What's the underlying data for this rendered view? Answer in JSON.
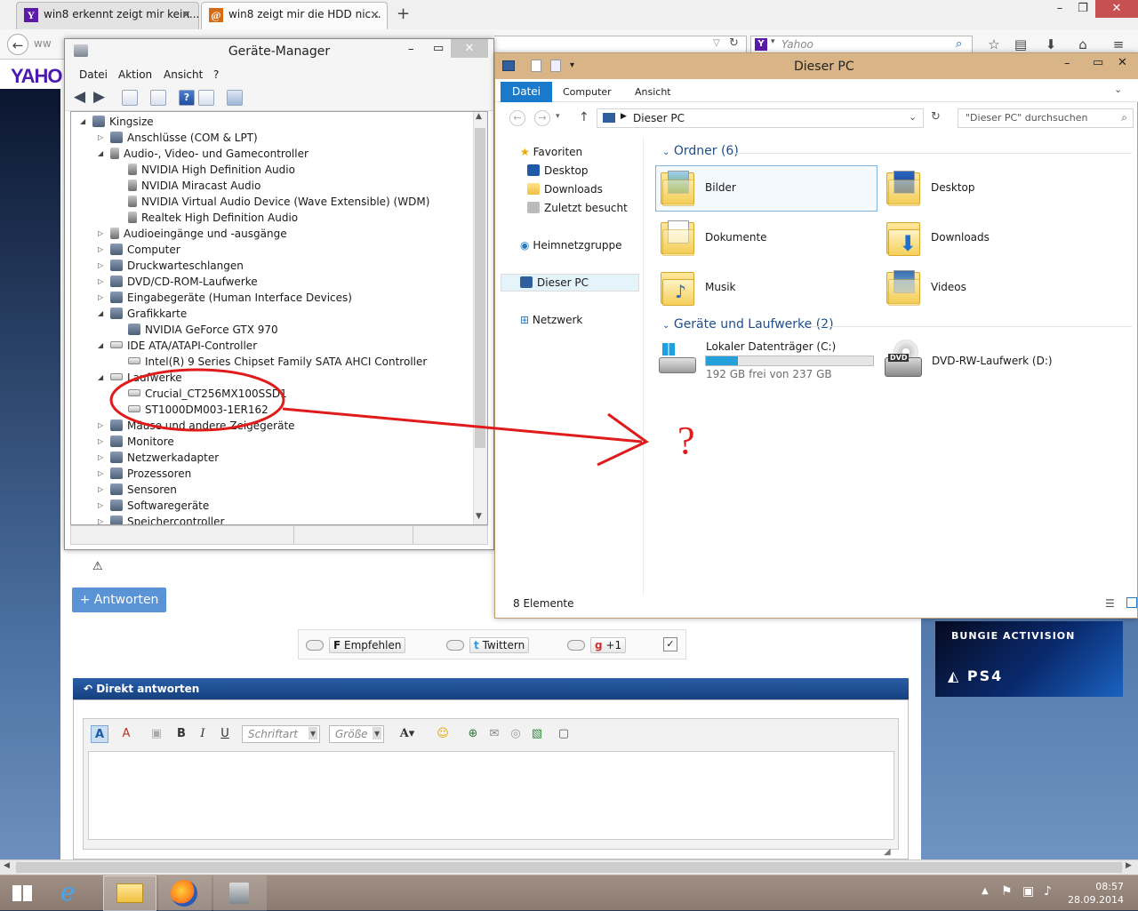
{
  "browser": {
    "tabs": [
      {
        "title": "win8 erkennt zeigt mir kein..."
      },
      {
        "title": "win8 zeigt mir die HDD nic..."
      }
    ],
    "new_tab": "+",
    "url_placeholder": "ww",
    "search_placeholder": "Yahoo",
    "page_logo": "YAHO"
  },
  "device_manager": {
    "title": "Geräte-Manager",
    "menu": [
      "Datei",
      "Aktion",
      "Ansicht",
      "?"
    ],
    "tree": [
      {
        "label": "Kingsize",
        "level": 0,
        "state": "open",
        "icon": "computer-icon"
      },
      {
        "label": "Anschlüsse (COM & LPT)",
        "level": 1,
        "state": "closed",
        "icon": "port-icon"
      },
      {
        "label": "Audio-, Video- und Gamecontroller",
        "level": 1,
        "state": "open",
        "icon": "speaker-icon"
      },
      {
        "label": "NVIDIA High Definition Audio",
        "level": 2,
        "state": "leaf",
        "icon": "speaker-icon"
      },
      {
        "label": "NVIDIA Miracast Audio",
        "level": 2,
        "state": "leaf",
        "icon": "speaker-icon"
      },
      {
        "label": "NVIDIA Virtual Audio Device (Wave Extensible) (WDM)",
        "level": 2,
        "state": "leaf",
        "icon": "speaker-icon"
      },
      {
        "label": "Realtek High Definition Audio",
        "level": 2,
        "state": "leaf",
        "icon": "speaker-icon"
      },
      {
        "label": "Audioeingänge und -ausgänge",
        "level": 1,
        "state": "closed",
        "icon": "speaker-icon"
      },
      {
        "label": "Computer",
        "level": 1,
        "state": "closed",
        "icon": "monitor-icon"
      },
      {
        "label": "Druckwarteschlangen",
        "level": 1,
        "state": "closed",
        "icon": "printer-icon"
      },
      {
        "label": "DVD/CD-ROM-Laufwerke",
        "level": 1,
        "state": "closed",
        "icon": "dvd-icon"
      },
      {
        "label": "Eingabegeräte (Human Interface Devices)",
        "level": 1,
        "state": "closed",
        "icon": "hid-icon"
      },
      {
        "label": "Grafikkarte",
        "level": 1,
        "state": "open",
        "icon": "monitor-icon"
      },
      {
        "label": "NVIDIA GeForce GTX 970",
        "level": 2,
        "state": "leaf",
        "icon": "monitor-icon"
      },
      {
        "label": "IDE ATA/ATAPI-Controller",
        "level": 1,
        "state": "open",
        "icon": "drive-icon"
      },
      {
        "label": "Intel(R) 9 Series Chipset Family SATA AHCI Controller",
        "level": 2,
        "state": "leaf",
        "icon": "drive-icon"
      },
      {
        "label": "Laufwerke",
        "level": 1,
        "state": "open",
        "icon": "drive-icon"
      },
      {
        "label": "Crucial_CT256MX100SSD1",
        "level": 2,
        "state": "leaf",
        "icon": "drive-icon"
      },
      {
        "label": "ST1000DM003-1ER162",
        "level": 2,
        "state": "leaf",
        "icon": "drive-icon"
      },
      {
        "label": "Mäuse und andere Zeigegeräte",
        "level": 1,
        "state": "closed",
        "icon": "mouse-icon"
      },
      {
        "label": "Monitore",
        "level": 1,
        "state": "closed",
        "icon": "monitor-icon"
      },
      {
        "label": "Netzwerkadapter",
        "level": 1,
        "state": "closed",
        "icon": "network-icon"
      },
      {
        "label": "Prozessoren",
        "level": 1,
        "state": "closed",
        "icon": "cpu-icon"
      },
      {
        "label": "Sensoren",
        "level": 1,
        "state": "closed",
        "icon": "sensor-icon"
      },
      {
        "label": "Softwaregeräte",
        "level": 1,
        "state": "closed",
        "icon": "software-icon"
      },
      {
        "label": "Speichercontroller",
        "level": 1,
        "state": "closed",
        "icon": "storage-icon"
      }
    ]
  },
  "explorer": {
    "title": "Dieser PC",
    "ribbon_tabs": [
      "Datei",
      "Computer",
      "Ansicht"
    ],
    "address": "Dieser PC",
    "search_placeholder": "\"Dieser PC\" durchsuchen",
    "nav": {
      "favorites": "Favoriten",
      "fav_items": [
        "Desktop",
        "Downloads",
        "Zuletzt besucht"
      ],
      "homegroup": "Heimnetzgruppe",
      "this_pc": "Dieser PC",
      "network": "Netzwerk"
    },
    "folders_header": "Ordner (6)",
    "folders": [
      "Bilder",
      "Desktop",
      "Dokumente",
      "Downloads",
      "Musik",
      "Videos"
    ],
    "drives_header": "Geräte und Laufwerke (2)",
    "drives": [
      {
        "name": "Lokaler Datenträger (C:)",
        "free": "192 GB frei von 237 GB",
        "used_fraction": 0.19
      },
      {
        "name": "DVD-RW-Laufwerk (D:)",
        "badge": "DVD"
      }
    ],
    "status": "8 Elemente"
  },
  "annotation": {
    "mark": "?",
    "color": "#e01b1b"
  },
  "forum": {
    "reply_button": "+ Antworten",
    "social": [
      {
        "label": "Empfehlen",
        "glyph": "F"
      },
      {
        "label": "Twittern",
        "glyph": "t"
      },
      {
        "label": "+1",
        "glyph": "g"
      }
    ],
    "reply_header": "Direkt antworten",
    "font_select": "Schriftart",
    "size_select": "Größe"
  },
  "ad": {
    "brands": "BUNGIE  ACTIVISION",
    "console": "PS4"
  },
  "taskbar": {
    "time": "08:57",
    "date": "28.09.2014"
  }
}
